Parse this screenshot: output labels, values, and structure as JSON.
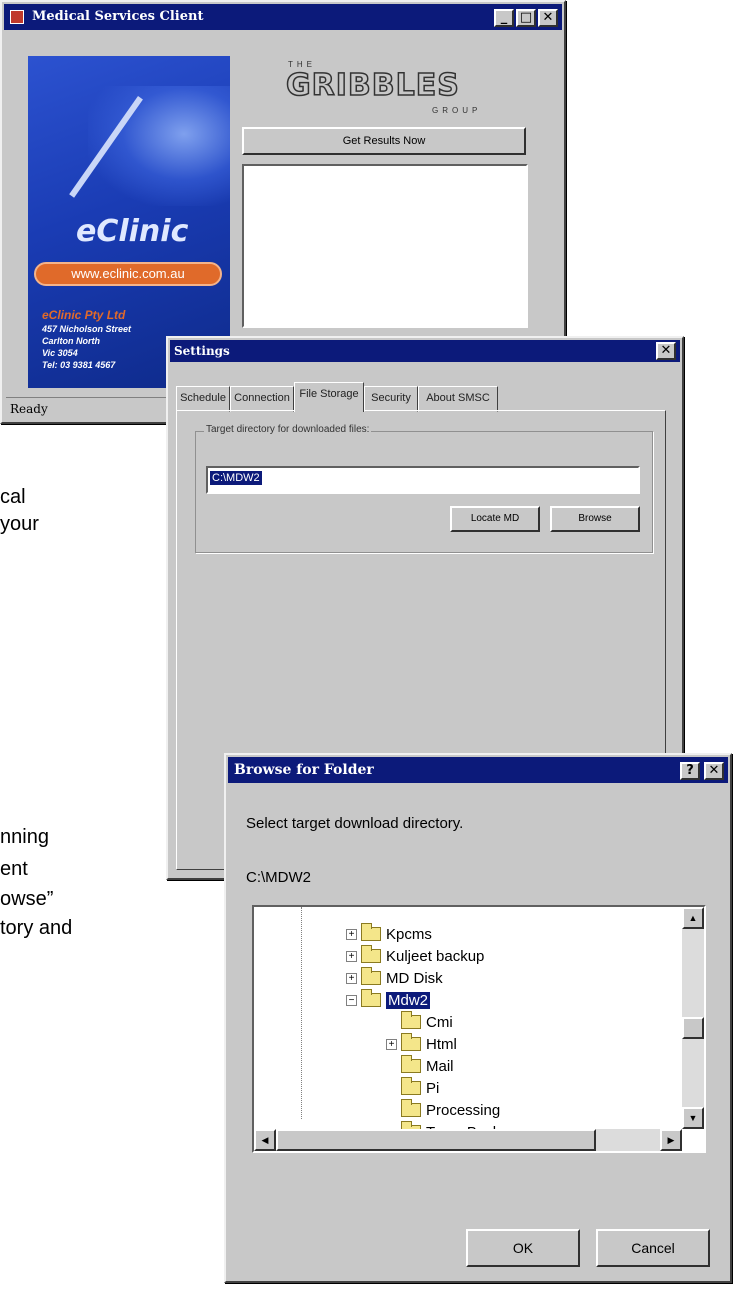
{
  "body_text": {
    "line1": "cal",
    "line2": "your",
    "line3": "nning",
    "line4": "ent",
    "line5": "owse”",
    "line6": "tory and"
  },
  "msc_window": {
    "title": "Medical Services Client",
    "title_icon": "app-icon",
    "buttons": [
      "minimize-icon",
      "maximize-icon",
      "close-icon"
    ],
    "logo": {
      "the": "THE",
      "name": "GRIBBLES",
      "group": "GROUP"
    },
    "get_results_label": "Get Results Now",
    "status": "Ready",
    "banner": {
      "brand": "eClinic",
      "url": "www.eclinic.com.au",
      "company": "eClinic Pty Ltd",
      "address_lines": [
        "457 Nicholson Street",
        "Carlton North",
        "Vic 3054",
        "Tel: 03 9381 4567"
      ]
    }
  },
  "settings_window": {
    "title": "Settings",
    "close_icon": "close-icon",
    "tabs": [
      "Schedule",
      "Connection",
      "File Storage",
      "Security",
      "About SMSC"
    ],
    "active_tab": "File Storage",
    "group_label": "Target directory for downloaded files:",
    "directory_value": "C:\\MDW2",
    "locate_label": "Locate MD",
    "browse_label": "Browse"
  },
  "browse_window": {
    "title": "Browse for Folder",
    "help_icon": "help-icon",
    "close_icon": "close-icon",
    "instruction": "Select target download directory.",
    "current_path": "C:\\MDW2",
    "tree": [
      {
        "label": "Kpcms",
        "expander": "+",
        "level": 0
      },
      {
        "label": "Kuljeet backup",
        "expander": "+",
        "level": 0
      },
      {
        "label": "MD Disk",
        "expander": "+",
        "level": 0
      },
      {
        "label": "Mdw2",
        "expander": "−",
        "level": 0,
        "selected": true
      },
      {
        "label": "Cmi",
        "expander": "",
        "level": 1
      },
      {
        "label": "Html",
        "expander": "+",
        "level": 1
      },
      {
        "label": "Mail",
        "expander": "",
        "level": 1
      },
      {
        "label": "Pi",
        "expander": "",
        "level": 1
      },
      {
        "label": "Processing",
        "expander": "",
        "level": 1
      },
      {
        "label": "Temp Backup",
        "expander": "",
        "level": 1
      }
    ],
    "ok_label": "OK",
    "cancel_label": "Cancel"
  },
  "colors": {
    "titlebar": "#0c1a7a",
    "window_face": "#c8c8c8",
    "selection": "#0c1a7a",
    "banner_blue": "#1a3cb4",
    "banner_orange": "#e06a2a"
  }
}
